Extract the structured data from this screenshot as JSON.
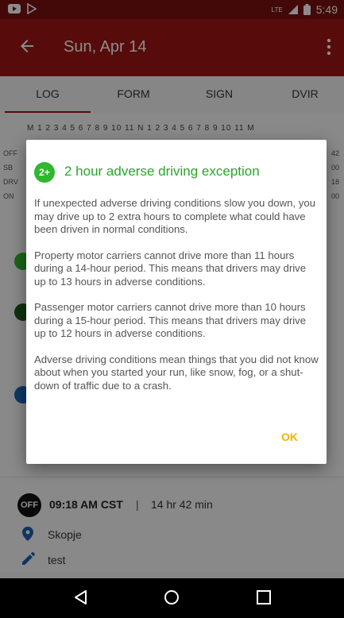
{
  "status_bar": {
    "time": "5:49",
    "lte_label": "LTE"
  },
  "app_bar": {
    "title": "Sun, Apr 14"
  },
  "tabs": [
    {
      "label": "LOG"
    },
    {
      "label": "FORM"
    },
    {
      "label": "SIGN"
    },
    {
      "label": "DVIR"
    }
  ],
  "grid": {
    "hours_header": "M 1 2 3 4 5 6 7 8 9 10 11 N 1 2 3 4 5 6 7 8 9 10 11 M",
    "row_labels": [
      "OFF",
      "SB",
      "DRV",
      "ON"
    ],
    "row_totals": [
      "42",
      "00",
      "18",
      "00"
    ]
  },
  "entry": {
    "badge": "OFF",
    "time": "09:18 AM CST",
    "separator": "|",
    "duration": "14 hr  42 min",
    "location": "Skopje",
    "note": "test"
  },
  "dialog": {
    "icon_label": "2+",
    "title": "2 hour adverse driving exception",
    "paragraphs": [
      "If unexpected adverse driving conditions slow you down, you may drive up to 2 extra hours to complete what could have been driven in normal conditions.",
      "Property motor carriers cannot drive more than 11 hours during a 14-hour period. This means that drivers may drive up to 13 hours in adverse conditions.",
      "Passenger motor carriers cannot drive more than 10 hours during a 15-hour period. This means that drivers may drive up to 12 hours in adverse conditions.",
      "Adverse driving conditions mean things that you did not know about when you started your run, like snow, fog, or a shut-down of traffic due to a crash."
    ],
    "ok_label": "OK"
  },
  "colors": {
    "app_bar": "#a01515",
    "status_bar": "#7b1010",
    "accent_green": "#2aa62a",
    "ok_yellow": "#f5b400"
  }
}
